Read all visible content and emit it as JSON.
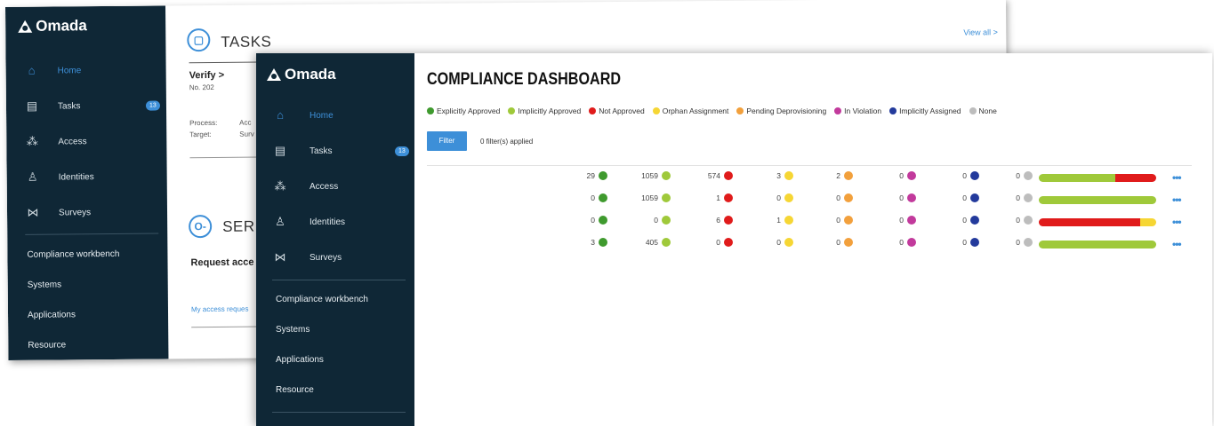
{
  "brand": "Omada",
  "colors": {
    "sidebar_bg": "#0f2736",
    "accent": "#3d8fd8",
    "explicitly_approved": "#3f9a2e",
    "implicitly_approved": "#9fc93a",
    "not_approved": "#e01b1b",
    "orphan_assignment": "#f6d634",
    "pending_deprovisioning": "#f2a03c",
    "in_violation": "#c23a9c",
    "implicitly_assigned": "#233a9c",
    "none": "#bdbdbd"
  },
  "sidebar": {
    "items": [
      {
        "label": "Home",
        "icon": "home-icon",
        "glyph": "⌂",
        "active": true
      },
      {
        "label": "Tasks",
        "icon": "tasks-icon",
        "glyph": "▤",
        "badge": "13"
      },
      {
        "label": "Access",
        "icon": "access-icon",
        "glyph": "⁂"
      },
      {
        "label": "Identities",
        "icon": "identities-icon",
        "glyph": "♙"
      },
      {
        "label": "Surveys",
        "icon": "surveys-icon",
        "glyph": "⋈"
      }
    ],
    "links": [
      "Compliance workbench",
      "Systems",
      "Applications",
      "Resource"
    ]
  },
  "back_content": {
    "tasks_title": "TASKS",
    "view_all": "View all >",
    "verify": "Verify >",
    "task_no": "No. 202",
    "process_label": "Process:",
    "process_value": "Acc",
    "target_label": "Target:",
    "target_value": "Surv",
    "services_title": "SER",
    "request_access": "Request acce",
    "my_access_requests": "My access reques"
  },
  "dashboard": {
    "title": "COMPLIANCE DASHBOARD",
    "legend": [
      {
        "label": "Explicitly Approved",
        "color": "#3f9a2e"
      },
      {
        "label": "Implicitly Approved",
        "color": "#9fc93a"
      },
      {
        "label": "Not Approved",
        "color": "#e01b1b"
      },
      {
        "label": "Orphan Assignment",
        "color": "#f6d634"
      },
      {
        "label": "Pending Deprovisioning",
        "color": "#f2a03c"
      },
      {
        "label": "In Violation",
        "color": "#c23a9c"
      },
      {
        "label": "Implicitly Assigned",
        "color": "#233a9c"
      },
      {
        "label": "None",
        "color": "#bdbdbd"
      }
    ],
    "filter_button": "Filter",
    "filter_status": "0 filter(s) applied",
    "rows": [
      {
        "values": [
          29,
          1059,
          574,
          3,
          2,
          0,
          0,
          0
        ]
      },
      {
        "values": [
          0,
          1059,
          1,
          0,
          0,
          0,
          0,
          0
        ]
      },
      {
        "values": [
          0,
          0,
          6,
          1,
          0,
          0,
          0,
          0
        ]
      },
      {
        "values": [
          3,
          405,
          0,
          0,
          0,
          0,
          0,
          0
        ]
      }
    ],
    "bar_fractions": [
      [
        0,
        0.65,
        0.35,
        0,
        0,
        0,
        0,
        0
      ],
      [
        0,
        1.0,
        0,
        0,
        0,
        0,
        0,
        0
      ],
      [
        0,
        0,
        0.86,
        0.14,
        0,
        0,
        0,
        0
      ],
      [
        0,
        1.0,
        0,
        0,
        0,
        0,
        0,
        0
      ]
    ],
    "more_label": "•••"
  }
}
